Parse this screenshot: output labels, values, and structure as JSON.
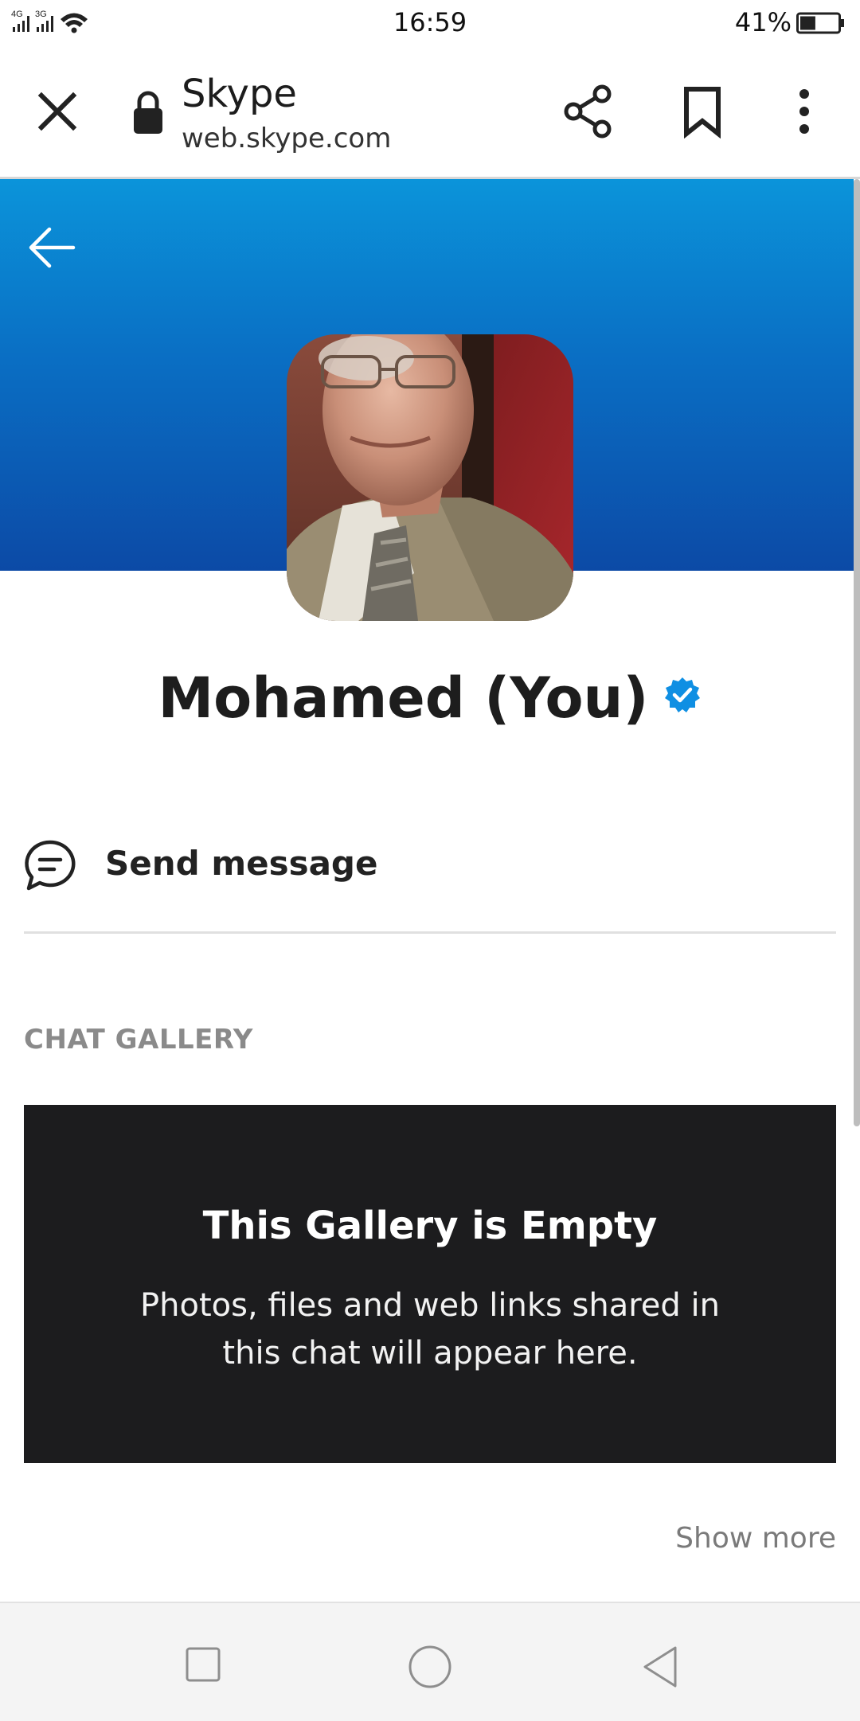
{
  "status_bar": {
    "network_1": "4G",
    "network_2": "3G",
    "time": "16:59",
    "battery_percent": "41%",
    "battery_level": 0.41,
    "icons": [
      "signal-4g-icon",
      "signal-3g-icon",
      "wifi-icon",
      "battery-icon"
    ]
  },
  "browser": {
    "title": "Skype",
    "url": "web.skype.com",
    "icons": [
      "close-icon",
      "lock-icon",
      "share-icon",
      "bookmark-icon",
      "more-vert-icon"
    ]
  },
  "profile": {
    "name": "Mohamed (You)",
    "verified": true,
    "header_colors": [
      "#0b94da",
      "#0c4aa6"
    ],
    "icons": [
      "back-arrow-icon",
      "verified-badge-icon"
    ]
  },
  "actions": {
    "send_message": "Send message",
    "icons": [
      "chat-bubble-icon"
    ]
  },
  "gallery": {
    "heading": "CHAT GALLERY",
    "empty_title": "This Gallery is Empty",
    "empty_description": "Photos, files and web links shared in this chat will appear here.",
    "show_more": "Show more"
  },
  "nav_bar": {
    "icons": [
      "recents-square-icon",
      "home-circle-icon",
      "back-triangle-icon"
    ]
  },
  "colors": {
    "accent": "#0b94da",
    "gallery_bg": "#1c1c1e"
  }
}
